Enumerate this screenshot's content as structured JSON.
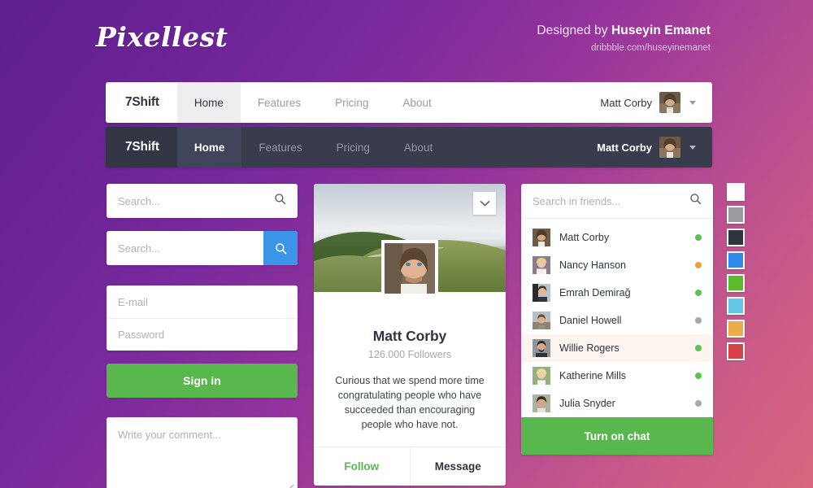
{
  "header": {
    "logo": "Pixellest",
    "credit_prefix": "Designed by ",
    "credit_author": "Huseyin Emanet",
    "credit_url": "dribbble.com/huseyinemanet"
  },
  "navbar_light": {
    "brand": "7Shift",
    "links": [
      {
        "label": "Home",
        "active": true
      },
      {
        "label": "Features",
        "active": false
      },
      {
        "label": "Pricing",
        "active": false
      },
      {
        "label": "About",
        "active": false
      }
    ],
    "user_name": "Matt Corby",
    "avatar_icon": "user-avatar",
    "caret_icon": "chevron-down-icon"
  },
  "navbar_dark": {
    "brand": "7Shift",
    "links": [
      {
        "label": "Home",
        "active": true
      },
      {
        "label": "Features",
        "active": false
      },
      {
        "label": "Pricing",
        "active": false
      },
      {
        "label": "About",
        "active": false
      }
    ],
    "user_name": "Matt Corby",
    "avatar_icon": "user-avatar",
    "caret_icon": "chevron-down-icon"
  },
  "left_column": {
    "search_plain": {
      "value": "",
      "placeholder": "Search...",
      "icon": "search-icon"
    },
    "search_button_group": {
      "value": "",
      "placeholder": "Search...",
      "button_icon": "search-icon",
      "button_color": "#3b95e8"
    },
    "login": {
      "email_value": "",
      "email_placeholder": "E-mail",
      "password_value": "",
      "password_placeholder": "Password",
      "submit_label": "Sign in",
      "submit_color": "#58b84e"
    },
    "comment": {
      "value": "",
      "placeholder": "Write your comment...",
      "resize_icon": "resize-grip-icon"
    }
  },
  "profile_card": {
    "cover_icon": "cover-photo",
    "cover_menu_icon": "chevron-down-icon",
    "avatar_icon": "profile-avatar",
    "name": "Matt Corby",
    "followers": "126.000 Followers",
    "bio": "Curious that we spend more time congratulating people who have succeeded than encouraging people who have not.",
    "actions": [
      {
        "label": "Follow",
        "color": "#58b84e"
      },
      {
        "label": "Message",
        "color": "#2e3442"
      }
    ]
  },
  "friends_card": {
    "search": {
      "value": "",
      "placeholder": "Search in friends...",
      "icon": "search-icon"
    },
    "friends": [
      {
        "name": "Matt Corby",
        "status": "online",
        "dot_color": "#5cc44c",
        "highlight": false
      },
      {
        "name": "Nancy Hanson",
        "status": "away",
        "dot_color": "#ec9f3a",
        "highlight": false
      },
      {
        "name": "Emrah Demirağ",
        "status": "online",
        "dot_color": "#5cc44c",
        "highlight": false
      },
      {
        "name": "Daniel Howell",
        "status": "offline",
        "dot_color": "#a8a8ae",
        "highlight": false
      },
      {
        "name": "Willie Rogers",
        "status": "online",
        "dot_color": "#5cc44c",
        "highlight": true
      },
      {
        "name": "Katherine Mills",
        "status": "online",
        "dot_color": "#5cc44c",
        "highlight": false
      },
      {
        "name": "Julia Snyder",
        "status": "offline",
        "dot_color": "#a8a8ae",
        "highlight": false
      }
    ],
    "footer_label": "Turn on chat",
    "footer_color": "#58b84e"
  },
  "swatches": [
    {
      "name": "white",
      "color": "#ffffff"
    },
    {
      "name": "gray",
      "color": "#9a9a9f"
    },
    {
      "name": "dark-navy",
      "color": "#2f3440"
    },
    {
      "name": "blue",
      "color": "#2f8bea"
    },
    {
      "name": "green",
      "color": "#5cb82c"
    },
    {
      "name": "light-blue",
      "color": "#61c6e8"
    },
    {
      "name": "orange",
      "color": "#edab49"
    },
    {
      "name": "red",
      "color": "#d8434a"
    }
  ],
  "background": {
    "gradient_from": "#5f2090",
    "gradient_to": "#d9667e"
  }
}
